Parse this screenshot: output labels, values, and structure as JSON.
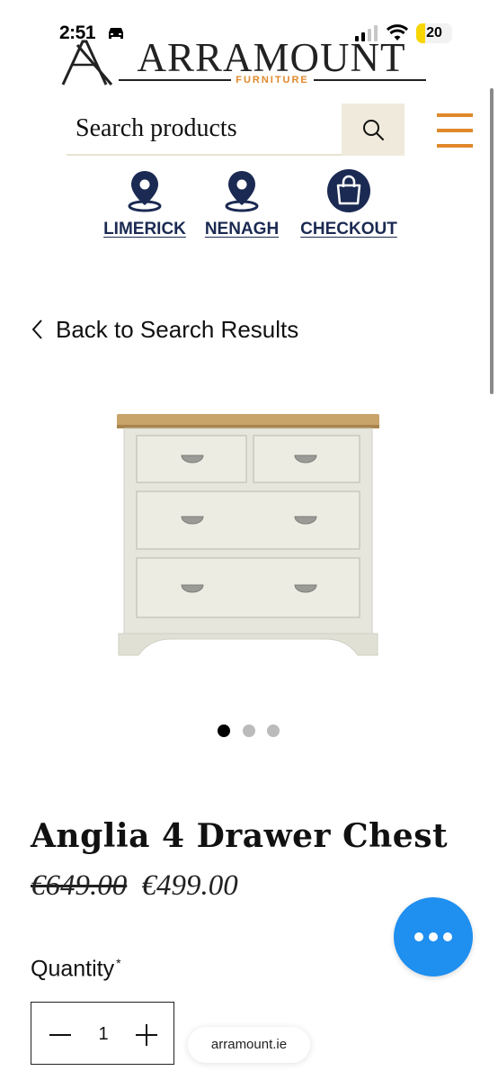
{
  "status_bar": {
    "time": "2:51",
    "battery": "20"
  },
  "header": {
    "logo_text": "ARRAMOUNT",
    "logo_subtext": "FURNITURE",
    "search_placeholder": "Search products",
    "locations": [
      {
        "label": "LIMERICK",
        "icon": "location-pin-icon"
      },
      {
        "label": "NENAGH",
        "icon": "location-pin-icon"
      },
      {
        "label": "CHECKOUT",
        "icon": "shopping-bag-icon"
      }
    ]
  },
  "navigation": {
    "back_label": "Back to Search Results"
  },
  "gallery": {
    "image_count": 3,
    "active_index": 0
  },
  "product": {
    "title": "Anglia 4 Drawer Chest",
    "old_price": "€649.00",
    "price": "€499.00"
  },
  "quantity": {
    "label": "Quantity",
    "required_marker": "*",
    "value": "1"
  },
  "browser": {
    "url": "arramount.ie"
  },
  "colors": {
    "brand_navy": "#1b2a52",
    "accent_orange": "#e0892b",
    "chat_button": "#1f8ff0",
    "search_button_bg": "#efeadb"
  }
}
